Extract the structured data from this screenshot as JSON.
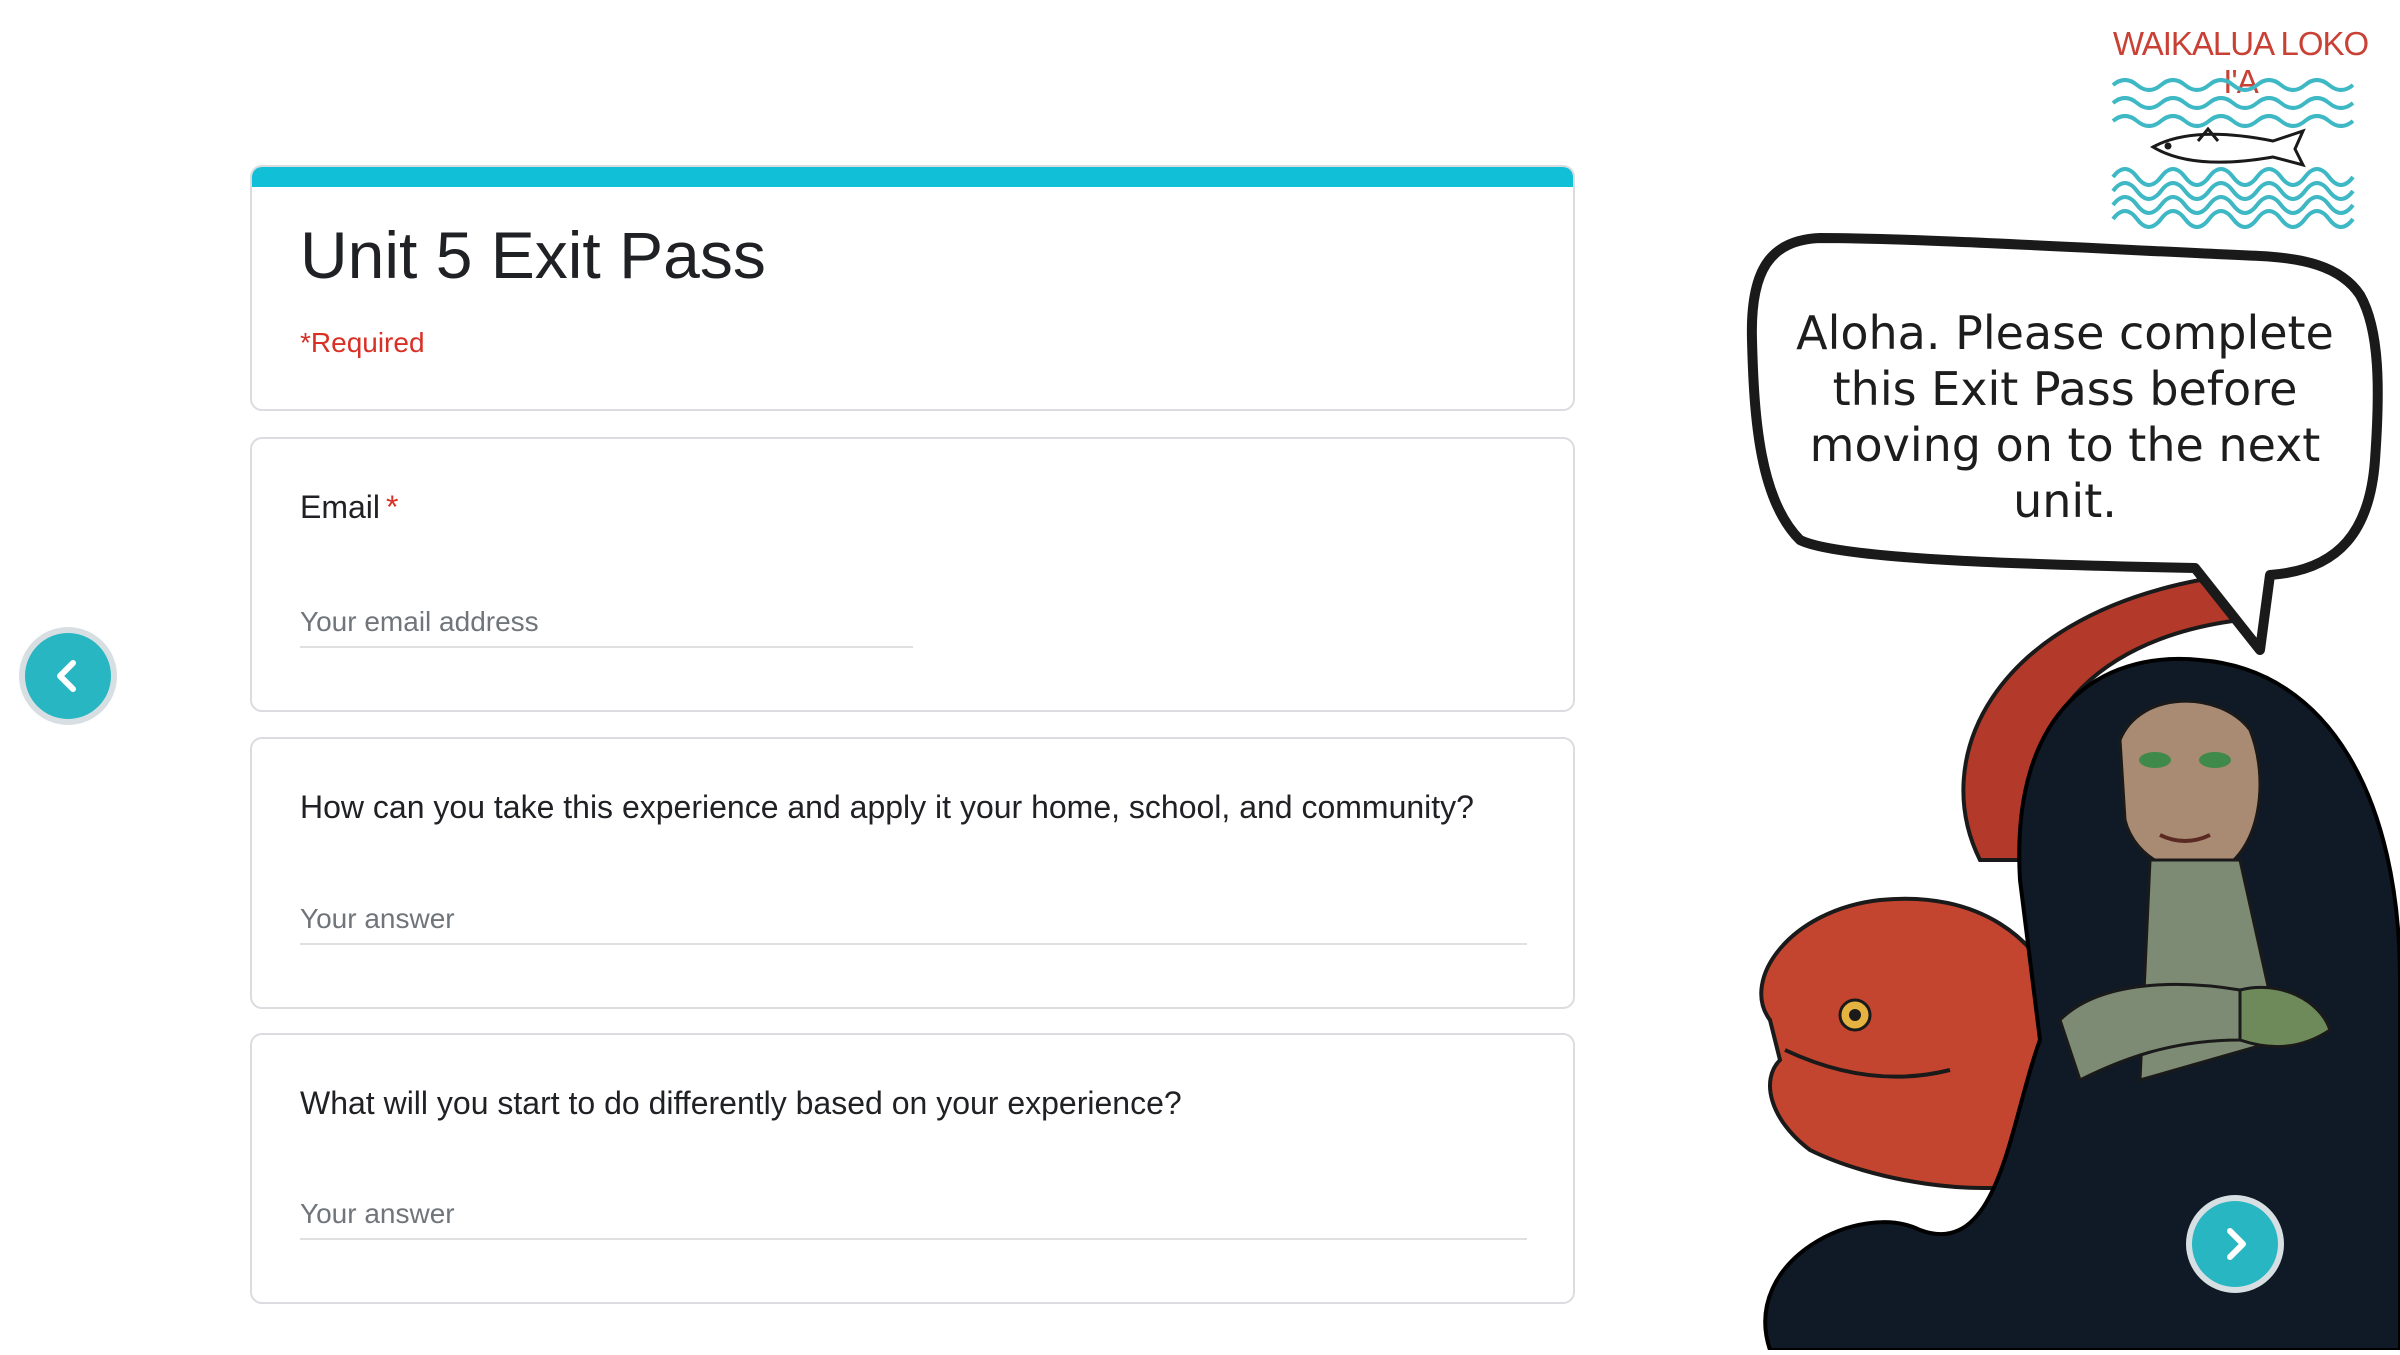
{
  "form": {
    "title": "Unit 5 Exit Pass",
    "required_note": "*Required",
    "accent_color": "#11bfd6"
  },
  "questions": [
    {
      "label": "Email",
      "required_marker": "*",
      "placeholder": "Your email address"
    },
    {
      "label": "How can you take this experience and apply it your home, school, and community?",
      "placeholder": "Your answer"
    },
    {
      "label": "What will you start to do differently based on your experience?",
      "placeholder": "Your answer"
    }
  ],
  "logo": {
    "text": "WAIKALUA LOKO I'A",
    "text_color": "#c94035",
    "wave_color": "#3fb8c5"
  },
  "speech_bubble": {
    "text": "Aloha. Please complete this Exit Pass before moving on to the next unit."
  },
  "nav": {
    "prev_icon": "chevron-left-icon",
    "next_icon": "chevron-right-icon",
    "button_color": "#27b6c2"
  }
}
